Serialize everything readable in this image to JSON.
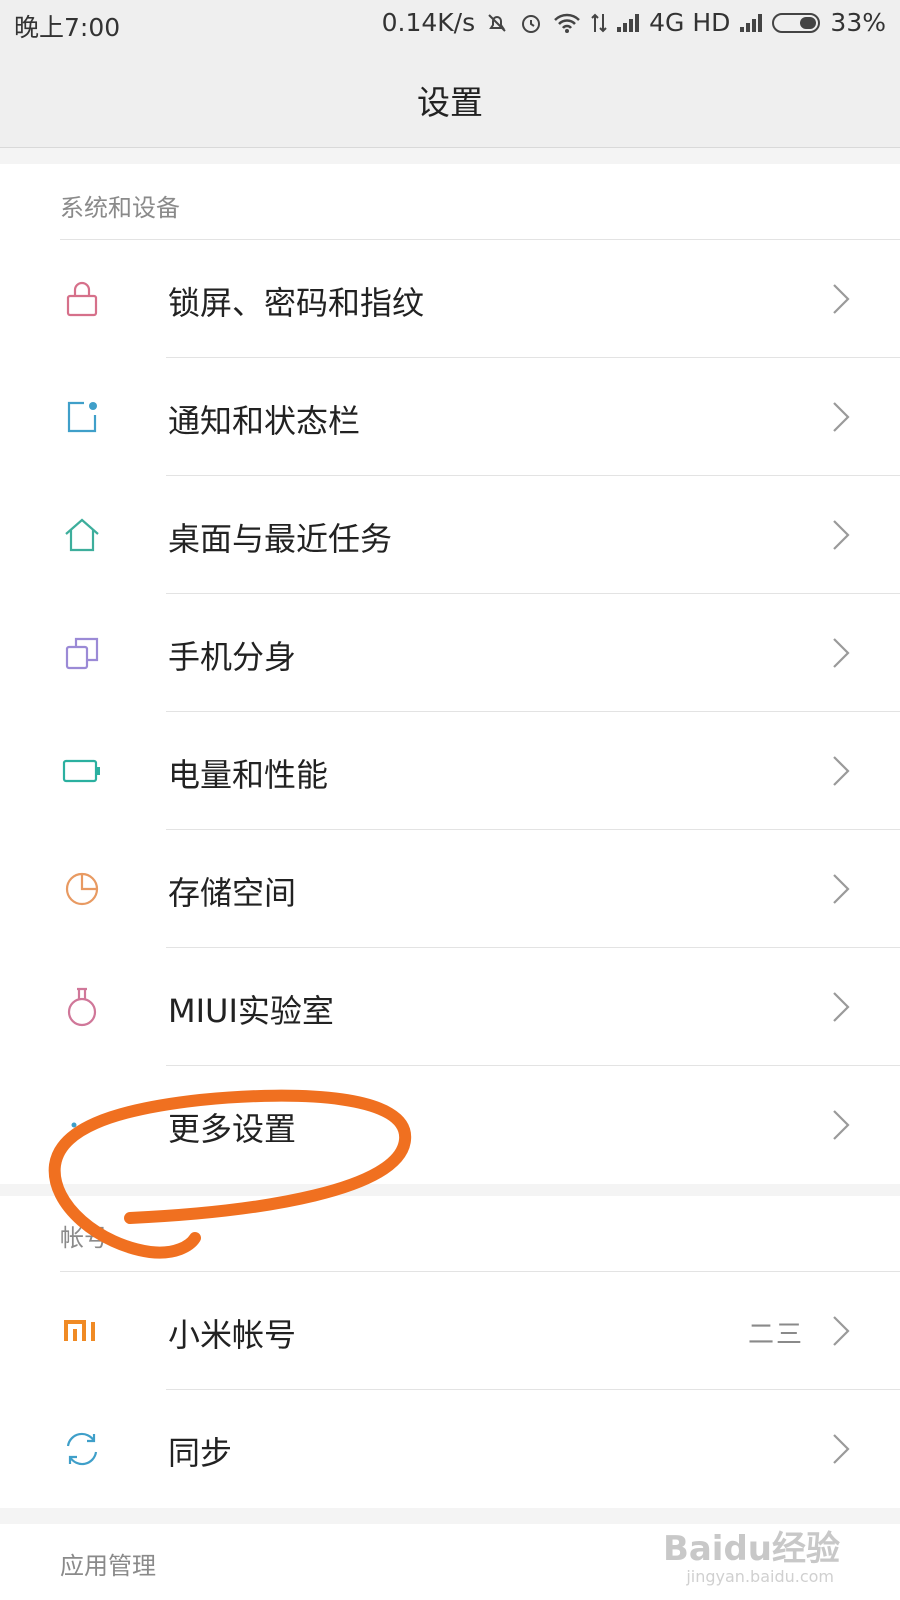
{
  "status_bar": {
    "time": "晚上7:00",
    "speed": "0.14K/s",
    "network": "4G HD",
    "battery": "33%"
  },
  "header": {
    "title": "设置"
  },
  "sections": {
    "system": {
      "title": "系统和设备",
      "items": [
        {
          "label": "锁屏、密码和指纹",
          "icon": "lock-icon",
          "color": "#d6708a"
        },
        {
          "label": "通知和状态栏",
          "icon": "notification-icon",
          "color": "#3f9fc9"
        },
        {
          "label": "桌面与最近任务",
          "icon": "home-icon",
          "color": "#3dae9c"
        },
        {
          "label": "手机分身",
          "icon": "dual-apps-icon",
          "color": "#9b8ad6"
        },
        {
          "label": "电量和性能",
          "icon": "battery-icon",
          "color": "#2bb0a0"
        },
        {
          "label": "存储空间",
          "icon": "storage-pie-icon",
          "color": "#e89a62"
        },
        {
          "label": "MIUI实验室",
          "icon": "flask-icon",
          "color": "#d07799"
        },
        {
          "label": "更多设置",
          "icon": "more-dots-icon",
          "color": "#3f9fc9"
        }
      ]
    },
    "account": {
      "title": "帐号",
      "items": [
        {
          "label": "小米帐号",
          "value": "二三",
          "icon": "mi-logo-icon",
          "color": "#f08a24"
        },
        {
          "label": "同步",
          "icon": "sync-icon",
          "color": "#3f9fc9"
        }
      ]
    },
    "apps": {
      "title": "应用管理"
    }
  },
  "watermark": {
    "text": "Baidu经验",
    "sub": "jingyan.baidu.com"
  },
  "colors": {
    "annotation": "#f07020",
    "divider": "#e3e3e3",
    "title_bar_bg": "#efefef"
  }
}
